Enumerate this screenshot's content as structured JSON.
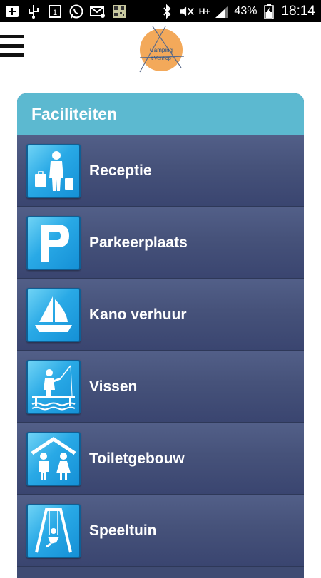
{
  "status_bar": {
    "battery": "43%",
    "time": "18:14",
    "network": "H+",
    "icons_left": [
      "add-icon",
      "usb-icon",
      "calendar-icon",
      "whatsapp-icon",
      "email-icon",
      "qr-icon"
    ],
    "icons_right": [
      "bluetooth-icon",
      "mute-icon",
      "network-icon",
      "signal-icon",
      "battery-icon"
    ]
  },
  "header": {
    "logo_line1": "Camping",
    "logo_line2": "t Venhop",
    "logo_color": "#f3a95a"
  },
  "panel": {
    "title": "Faciliteiten",
    "header_color": "#5cb9d0",
    "items": [
      {
        "label": "Receptie",
        "icon": "reception-icon"
      },
      {
        "label": "Parkeerplaats",
        "icon": "parking-icon"
      },
      {
        "label": "Kano verhuur",
        "icon": "sailboat-icon"
      },
      {
        "label": "Vissen",
        "icon": "fishing-icon"
      },
      {
        "label": "Toiletgebouw",
        "icon": "toilet-icon"
      },
      {
        "label": "Speeltuin",
        "icon": "playground-icon"
      }
    ]
  }
}
